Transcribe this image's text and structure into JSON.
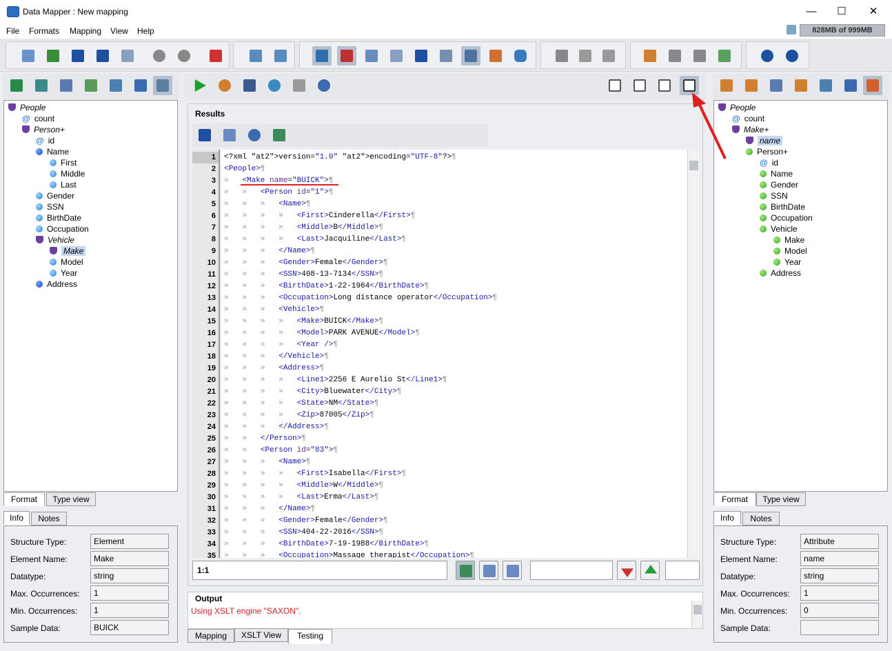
{
  "window": {
    "title": "Data Mapper : New mapping",
    "minimize": "—",
    "maximize": "☐",
    "close": "✕"
  },
  "menu": [
    "File",
    "Formats",
    "Mapping",
    "View",
    "Help"
  ],
  "memory": "828MB of 999MB",
  "left_tree": [
    {
      "label": "People",
      "type": "shield",
      "italic": true,
      "indent": 0
    },
    {
      "label": "count",
      "type": "attr",
      "indent": 1
    },
    {
      "label": "Person+",
      "type": "shield",
      "italic": true,
      "indent": 1
    },
    {
      "label": "id",
      "type": "attr",
      "indent": 2
    },
    {
      "label": "Name",
      "type": "blue",
      "indent": 2
    },
    {
      "label": "First",
      "type": "lightblue",
      "indent": 3
    },
    {
      "label": "Middle",
      "type": "lightblue",
      "indent": 3
    },
    {
      "label": "Last",
      "type": "lightblue",
      "indent": 3
    },
    {
      "label": "Gender",
      "type": "lightblue",
      "indent": 2
    },
    {
      "label": "SSN",
      "type": "lightblue",
      "indent": 2
    },
    {
      "label": "BirthDate",
      "type": "lightblue",
      "indent": 2
    },
    {
      "label": "Occupation",
      "type": "lightblue",
      "indent": 2
    },
    {
      "label": "Vehicle",
      "type": "shield",
      "italic": true,
      "indent": 2
    },
    {
      "label": "Make",
      "type": "shield",
      "italic": true,
      "selected": true,
      "indent": 3
    },
    {
      "label": "Model",
      "type": "lightblue",
      "indent": 3
    },
    {
      "label": "Year",
      "type": "lightblue",
      "indent": 3
    },
    {
      "label": "Address",
      "type": "blue",
      "indent": 2
    }
  ],
  "right_tree": [
    {
      "label": "People",
      "type": "shield",
      "italic": true,
      "indent": 0
    },
    {
      "label": "count",
      "type": "attr",
      "indent": 1
    },
    {
      "label": "Make+",
      "type": "shield",
      "italic": true,
      "indent": 1
    },
    {
      "label": "name",
      "type": "vshield",
      "italic": true,
      "selected": true,
      "indent": 2
    },
    {
      "label": "Person+",
      "type": "green",
      "indent": 2
    },
    {
      "label": "id",
      "type": "attr",
      "indent": 3
    },
    {
      "label": "Name",
      "type": "green",
      "indent": 3
    },
    {
      "label": "Gender",
      "type": "green",
      "indent": 3
    },
    {
      "label": "SSN",
      "type": "green",
      "indent": 3
    },
    {
      "label": "BirthDate",
      "type": "green",
      "indent": 3
    },
    {
      "label": "Occupation",
      "type": "green",
      "indent": 3
    },
    {
      "label": "Vehicle",
      "type": "green",
      "indent": 3
    },
    {
      "label": "Make",
      "type": "green",
      "indent": 4
    },
    {
      "label": "Model",
      "type": "green",
      "indent": 4
    },
    {
      "label": "Year",
      "type": "green",
      "indent": 4
    },
    {
      "label": "Address",
      "type": "green",
      "indent": 3
    }
  ],
  "left_tabs": {
    "format": "Format",
    "type_view": "Type view",
    "info": "Info",
    "notes": "Notes"
  },
  "right_tabs": {
    "format": "Format",
    "type_view": "Type view",
    "info": "Info",
    "notes": "Notes"
  },
  "left_info": {
    "labels": [
      "Structure Type:",
      "Element Name:",
      "Datatype:",
      "Max. Occurrences:",
      "Min. Occurrences:",
      "Sample Data:"
    ],
    "values": [
      "Element",
      "Make",
      "string",
      "1",
      "1",
      "BUICK"
    ]
  },
  "right_info": {
    "labels": [
      "Structure Type:",
      "Element Name:",
      "Datatype:",
      "Max. Occurrences:",
      "Min. Occurrences:",
      "Sample Data:"
    ],
    "values": [
      "Attribute",
      "name",
      "string",
      "1",
      "0",
      ""
    ]
  },
  "results": {
    "title": "Results",
    "position": "1:1",
    "lines": [
      "<?xml version=\"1.0\" encoding=\"UTF-8\"?>",
      "<People>",
      "  <Make name=\"BUICK\">",
      "    <Person id=\"1\">",
      "      <Name>",
      "        <First>Cinderella</First>",
      "        <Middle>B</Middle>",
      "        <Last>Jacquiline</Last>",
      "      </Name>",
      "      <Gender>Female</Gender>",
      "      <SSN>408-13-7134</SSN>",
      "      <BirthDate>1-22-1964</BirthDate>",
      "      <Occupation>Long distance operator</Occupation>",
      "      <Vehicle>",
      "        <Make>BUICK</Make>",
      "        <Model>PARK AVENUE</Model>",
      "        <Year />",
      "      </Vehicle>",
      "      <Address>",
      "        <Line1>2256 E Aurelio St</Line1>",
      "        <City>Bluewater</City>",
      "        <State>NM</State>",
      "        <Zip>87005</Zip>",
      "      </Address>",
      "    </Person>",
      "    <Person id=\"83\">",
      "      <Name>",
      "        <First>Isabella</First>",
      "        <Middle>W</Middle>",
      "        <Last>Erma</Last>",
      "      </Name>",
      "      <Gender>Female</Gender>",
      "      <SSN>404-22-2016</SSN>",
      "      <BirthDate>7-19-1988</BirthDate>",
      "      <Occupation>Massage therapist</Occupation>"
    ]
  },
  "output": {
    "title": "Output",
    "message": "Using XSLT engine \"SAXON\"."
  },
  "bottom_tabs": [
    "Mapping",
    "XSLT View",
    "Testing"
  ],
  "colors": {
    "accent_red": "#e02020",
    "selection": "#c5d7f2",
    "output_text": "#cc2222"
  }
}
